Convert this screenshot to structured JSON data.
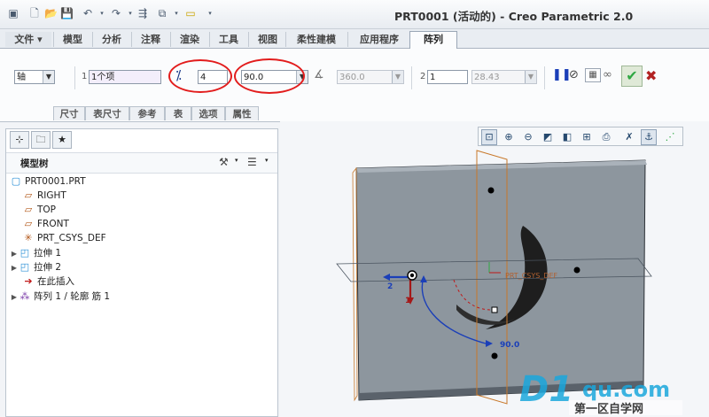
{
  "window": {
    "title": "PRT0001 (活动的) - Creo Parametric 2.0"
  },
  "quick_access": [
    "new-icon",
    "open-icon",
    "save-icon",
    "undo-icon",
    "redo-icon",
    "regenerate-icon",
    "windows-icon",
    "close-window-icon",
    "customize-icon"
  ],
  "ribbon_tabs": [
    {
      "label": "文件",
      "has_dropdown": true
    },
    {
      "label": "模型"
    },
    {
      "label": "分析"
    },
    {
      "label": "注释"
    },
    {
      "label": "渲染"
    },
    {
      "label": "工具"
    },
    {
      "label": "视图"
    },
    {
      "label": "柔性建模"
    },
    {
      "label": "应用程序"
    },
    {
      "label": "阵列",
      "active": true
    }
  ],
  "pattern": {
    "type_value": "轴",
    "ref_index": "1",
    "ref_value": "1个项",
    "count_value": "4",
    "angle_value": "90.0",
    "range_value": "360.0",
    "second_index": "2",
    "second_count": "1",
    "second_spacing": "28.43"
  },
  "subtabs": [
    "尺寸",
    "表尺寸",
    "参考",
    "表",
    "选项",
    "属性"
  ],
  "model_tree": {
    "header": "模型树",
    "items": [
      {
        "label": "PRT0001.PRT",
        "icon": "part-icon"
      },
      {
        "label": "RIGHT",
        "icon": "datum-plane-icon"
      },
      {
        "label": "TOP",
        "icon": "datum-plane-icon"
      },
      {
        "label": "FRONT",
        "icon": "datum-plane-icon"
      },
      {
        "label": "PRT_CSYS_DEF",
        "icon": "csys-icon"
      },
      {
        "label": "拉伸 1",
        "icon": "extrude-icon",
        "expandable": true
      },
      {
        "label": "拉伸 2",
        "icon": "extrude-icon",
        "expandable": true
      },
      {
        "label": "在此插入",
        "icon": "insert-arrow-icon"
      },
      {
        "label": "阵列 1 / 轮廓 筋 1",
        "icon": "pattern-icon",
        "expandable": true
      }
    ]
  },
  "viewport": {
    "csys_label": "PRT_CSYS_DEF",
    "dim_angle": "90.0",
    "dir1_label": "2",
    "dir2_label": "1"
  },
  "watermark": {
    "brand": "D1qu.com",
    "subtitle": "第一区自学网"
  },
  "colors": {
    "accent_red": "#e21c1c",
    "ok_green": "#2fa843",
    "cancel_red": "#b22222",
    "pattern_blue": "#1b3fb8"
  }
}
